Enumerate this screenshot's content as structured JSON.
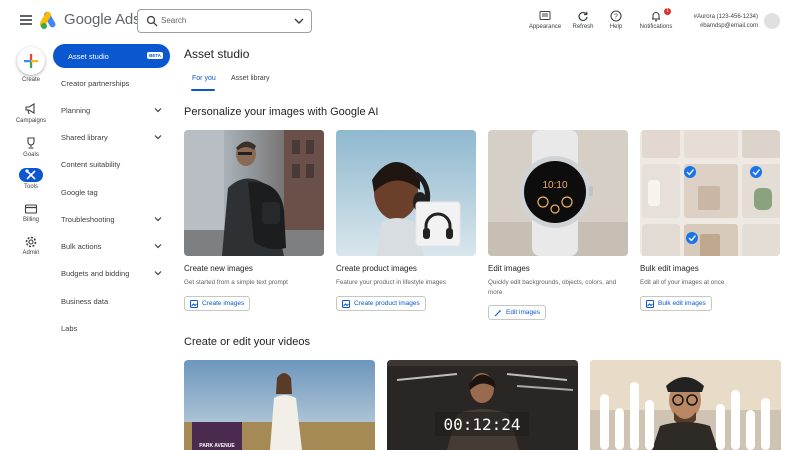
{
  "header": {
    "brand": "Google Ads",
    "search_placeholder": "Search",
    "actions": [
      {
        "label": "Appearance",
        "icon": "appearance-icon"
      },
      {
        "label": "Refresh",
        "icon": "refresh-icon"
      },
      {
        "label": "Help",
        "icon": "help-icon"
      },
      {
        "label": "Notifications",
        "icon": "bell-icon",
        "badge": "1"
      }
    ],
    "account_line1": "#Aurora (123-456-1234)",
    "account_line2": "#bamdsp@email.com"
  },
  "rail": {
    "items": [
      {
        "label": "Create",
        "icon": "plus-icon"
      },
      {
        "label": "Campaigns",
        "icon": "megaphone-icon"
      },
      {
        "label": "Goals",
        "icon": "trophy-icon"
      },
      {
        "label": "Tools",
        "icon": "tools-icon",
        "active": true
      },
      {
        "label": "Billing",
        "icon": "credit-card-icon"
      },
      {
        "label": "Admin",
        "icon": "gear-icon"
      }
    ]
  },
  "nav": {
    "items": [
      {
        "label": "Asset studio",
        "badge": "BETA",
        "active": true
      },
      {
        "label": "Creator partnerships"
      },
      {
        "label": "Planning",
        "expandable": true
      },
      {
        "label": "Shared library",
        "expandable": true
      },
      {
        "label": "Content suitability"
      },
      {
        "label": "Google tag"
      },
      {
        "label": "Troubleshooting",
        "expandable": true
      },
      {
        "label": "Bulk actions",
        "expandable": true
      },
      {
        "label": "Budgets and bidding",
        "expandable": true
      },
      {
        "label": "Business data"
      },
      {
        "label": "Labs"
      }
    ]
  },
  "main": {
    "title": "Asset studio",
    "tabs": [
      {
        "label": "For you",
        "active": true
      },
      {
        "label": "Asset library"
      }
    ],
    "images_section_title": "Personalize your images with Google AI",
    "cards": [
      {
        "title": "Create new images",
        "desc": "Get started from a simple text prompt",
        "button": "Create images"
      },
      {
        "title": "Create product images",
        "desc": "Feature your product in lifestyle images",
        "button": "Create product images"
      },
      {
        "title": "Edit images",
        "desc": "Quickly edit backgrounds, objects, colors, and more",
        "button": "Edit images"
      },
      {
        "title": "Bulk edit images",
        "desc": "Edit all of your images at once",
        "button": "Bulk edit images"
      }
    ],
    "videos_section_title": "Create or edit your videos",
    "video_cards": [
      {
        "overlay": "PARK AVENUE"
      },
      {
        "overlay": "00:12:24"
      },
      {
        "overlay": ""
      }
    ],
    "watch_time": "10:10",
    "accent_color": "#0b57d0"
  }
}
